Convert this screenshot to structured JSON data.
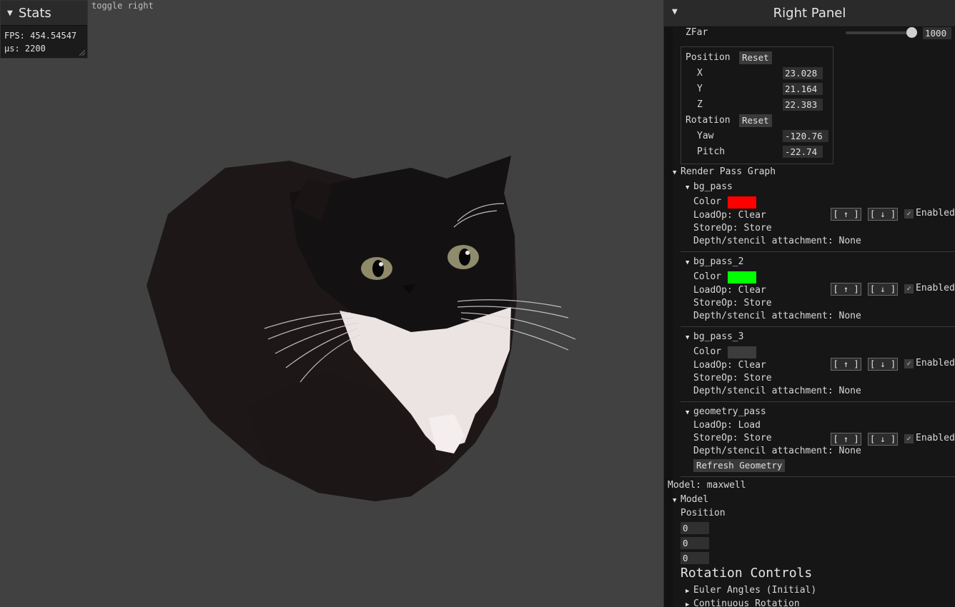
{
  "viewport": {
    "toggle_label": "toggle right"
  },
  "stats": {
    "title": "Stats",
    "fps": "FPS: 454.54547",
    "us": "µs: 2200"
  },
  "panel": {
    "title": "Right Panel",
    "camera": {
      "zfar_label": "ZFar",
      "zfar_value": "1000",
      "position_label": "Position",
      "reset_label": "Reset",
      "x_label": "X",
      "x_value": "23.028",
      "y_label": "Y",
      "y_value": "21.164",
      "z_label": "Z",
      "z_value": "22.383",
      "rotation_label": "Rotation",
      "yaw_label": "Yaw",
      "yaw_value": "-120.76",
      "pitch_label": "Pitch",
      "pitch_value": "-22.74"
    },
    "render_pass_graph": {
      "title": "Render Pass Graph",
      "color_label": "Color",
      "up_label": "[ ↑ ]",
      "down_label": "[ ↓ ]",
      "enabled_label": "Enabled",
      "check_glyph": "✓",
      "passes": [
        {
          "name": "bg_pass",
          "color": "#ff0000",
          "load_op": "LoadOp: Clear",
          "store_op": "StoreOp: Store",
          "depth": "Depth/stencil attachment: None"
        },
        {
          "name": "bg_pass_2",
          "color": "#00ff00",
          "load_op": "LoadOp: Clear",
          "store_op": "StoreOp: Store",
          "depth": "Depth/stencil attachment: None"
        },
        {
          "name": "bg_pass_3",
          "color": "#3c3c3c",
          "load_op": "LoadOp: Clear",
          "store_op": "StoreOp: Store",
          "depth": "Depth/stencil attachment: None"
        },
        {
          "name": "geometry_pass",
          "load_op": "LoadOp: Load",
          "store_op": "StoreOp: Store",
          "depth": "Depth/stencil attachment: None",
          "action_label": "Refresh Geometry"
        }
      ]
    },
    "model": {
      "label": "Model: maxwell",
      "section_title": "Model",
      "position_label": "Position",
      "position_values": [
        "0",
        "0",
        "0"
      ],
      "rotation_title": "Rotation Controls",
      "euler_label": "Euler Angles (Initial)",
      "continuous_label": "Continuous Rotation"
    }
  }
}
